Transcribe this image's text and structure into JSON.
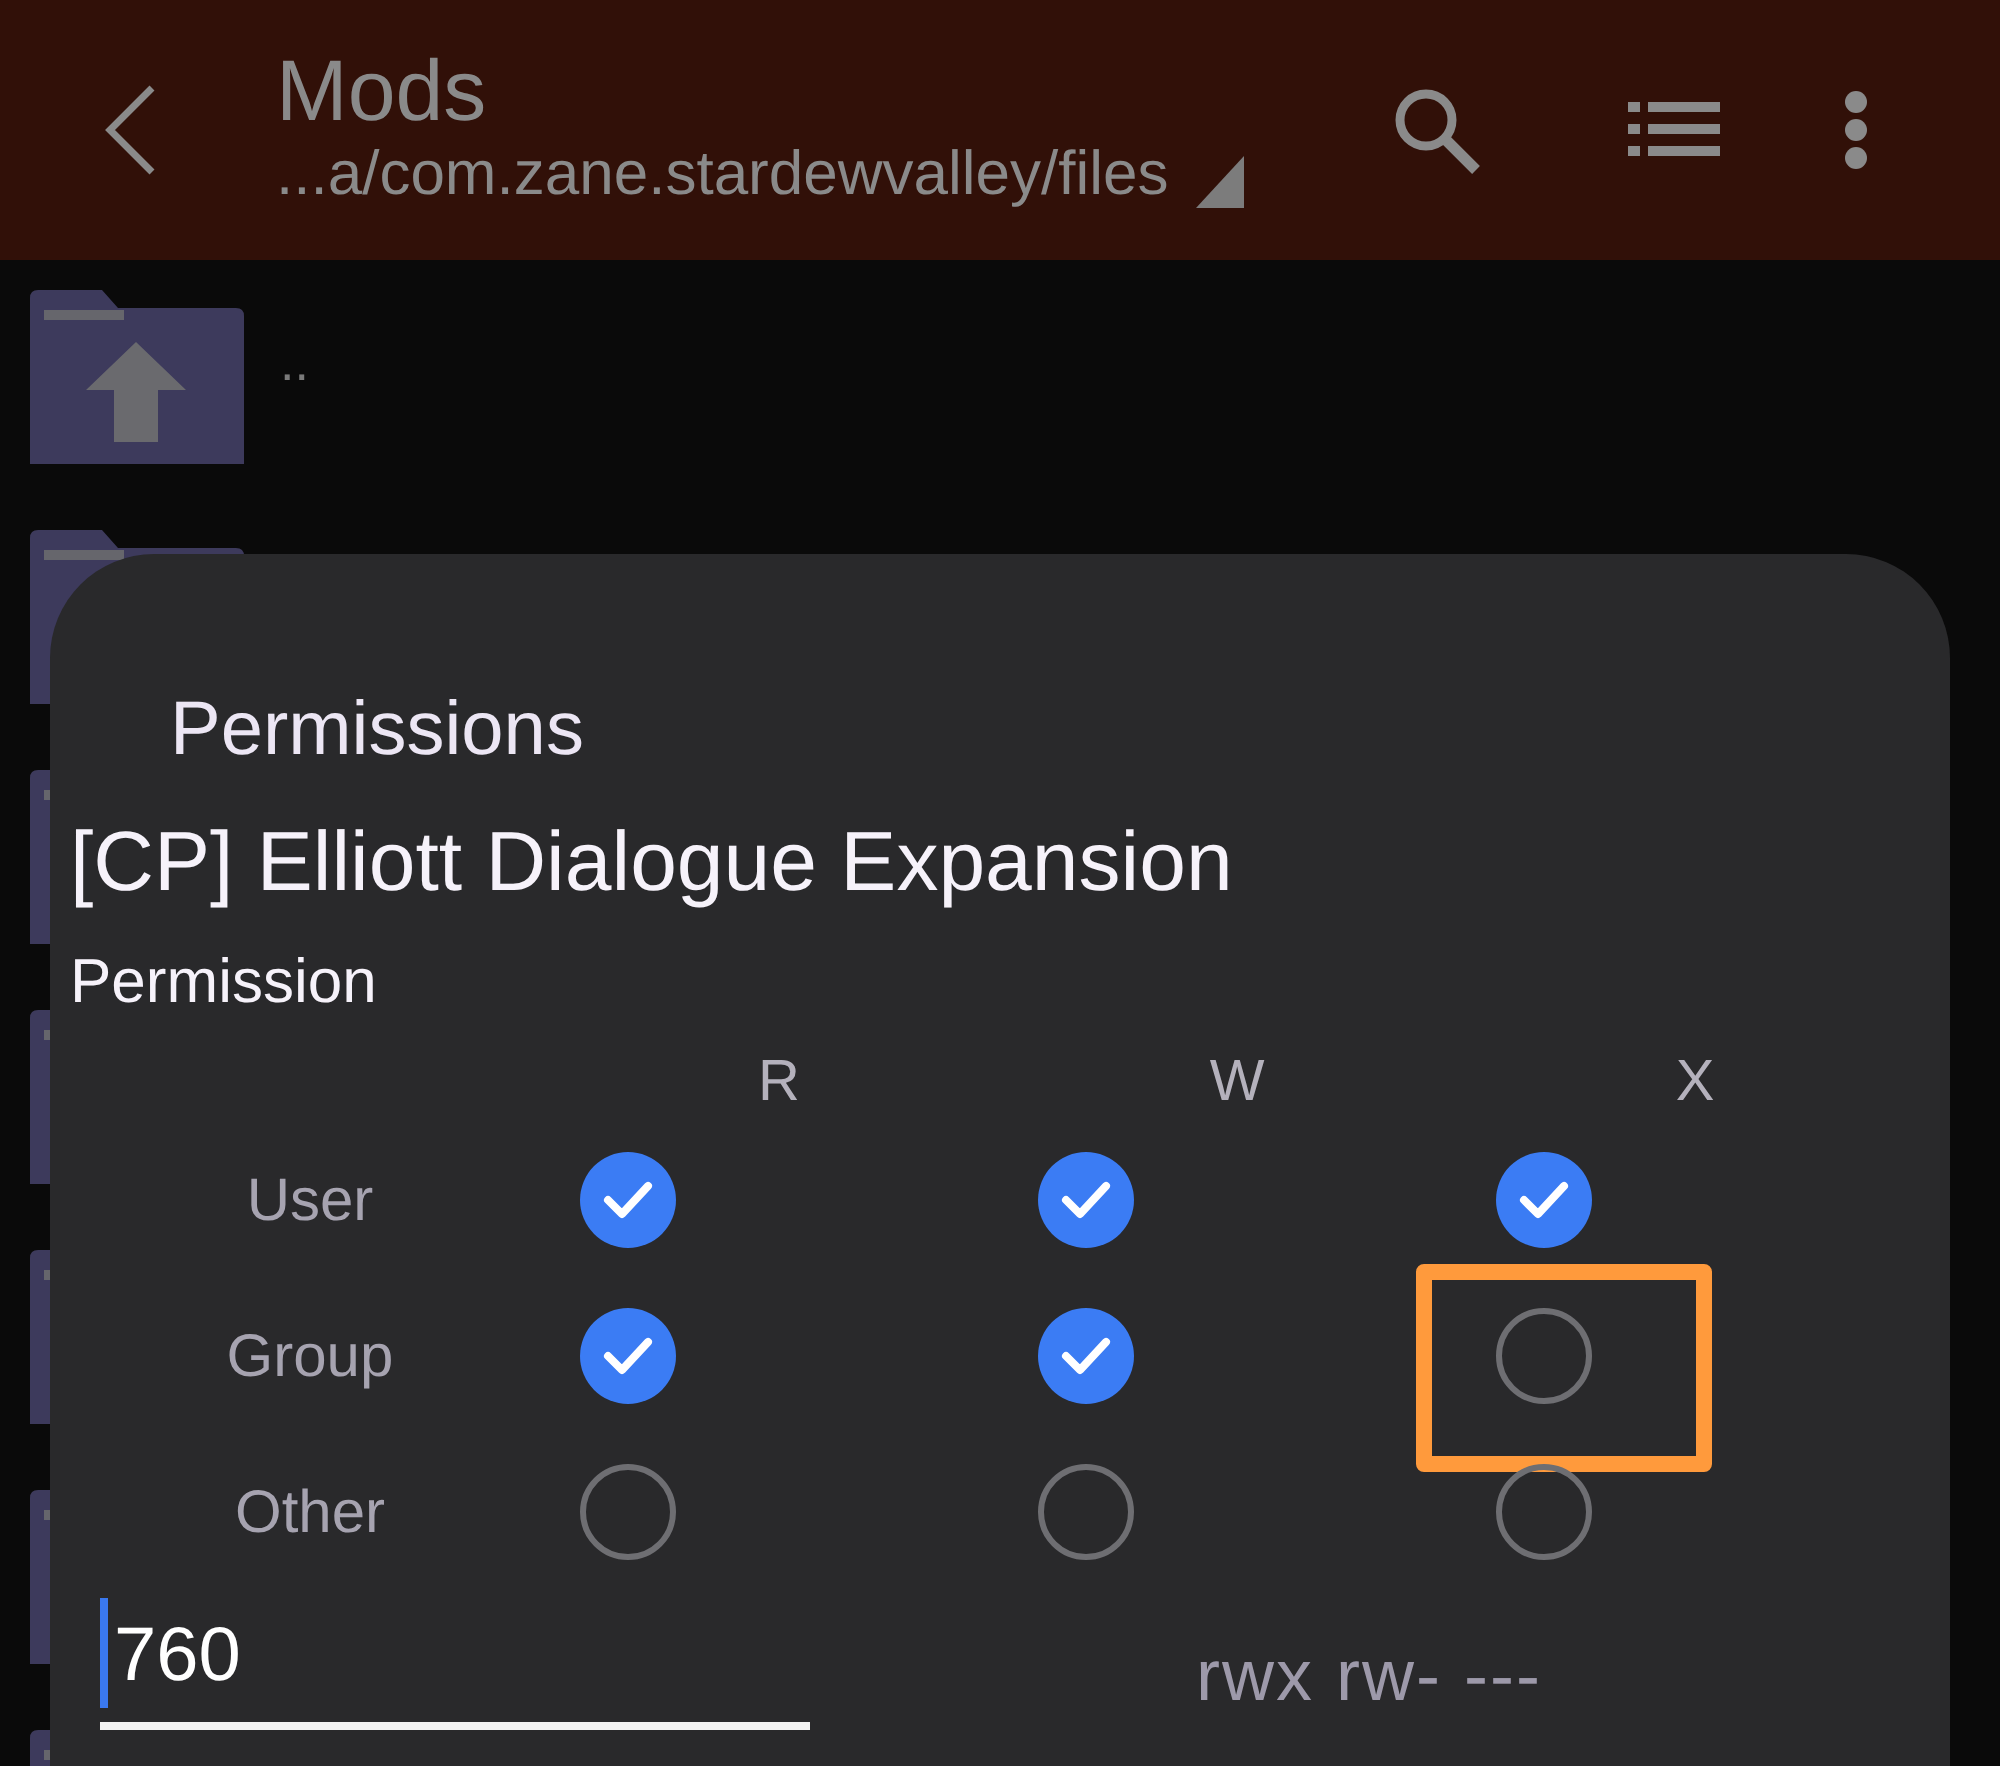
{
  "app_bar": {
    "title": "Mods",
    "path": "...a/com.zane.stardewvalley/files"
  },
  "file_list": [
    {
      "kind": "parent",
      "name": ".."
    },
    {
      "kind": "folder"
    },
    {
      "kind": "folder"
    },
    {
      "kind": "folder"
    },
    {
      "kind": "folder"
    },
    {
      "kind": "folder"
    },
    {
      "kind": "folder"
    }
  ],
  "dialog": {
    "title": "Permissions",
    "file_name": "[CP] Elliott Dialogue Expansion",
    "section": "Permission",
    "columns": [
      "R",
      "W",
      "X"
    ],
    "rows": [
      {
        "label": "User",
        "cells": [
          {
            "checked": true,
            "highlighted": false
          },
          {
            "checked": true,
            "highlighted": false
          },
          {
            "checked": true,
            "highlighted": false
          }
        ]
      },
      {
        "label": "Group",
        "cells": [
          {
            "checked": true,
            "highlighted": false
          },
          {
            "checked": true,
            "highlighted": false
          },
          {
            "checked": false,
            "highlighted": true
          }
        ]
      },
      {
        "label": "Other",
        "cells": [
          {
            "checked": false,
            "highlighted": false
          },
          {
            "checked": false,
            "highlighted": false
          },
          {
            "checked": false,
            "highlighted": false
          }
        ]
      }
    ],
    "octal": "760",
    "symbolic": "rwx rw- ---"
  }
}
